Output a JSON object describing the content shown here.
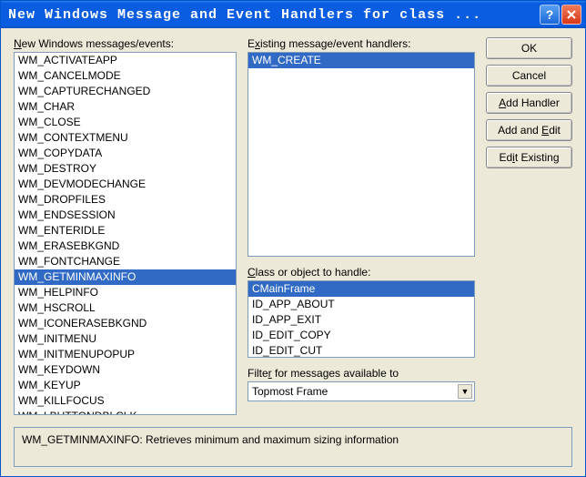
{
  "title": "New Windows Message and Event Handlers for class ...",
  "labels": {
    "new_messages": "New Windows messages/events:",
    "existing": "Existing message/event handlers:",
    "class": "Class or object to handle:",
    "filter": "Filter for messages available to"
  },
  "buttons": {
    "ok": "OK",
    "cancel": "Cancel",
    "add_handler": "Add Handler",
    "add_and_edit": "Add and Edit",
    "edit_existing": "Edit Existing"
  },
  "new_messages": {
    "items": [
      "WM_ACTIVATEAPP",
      "WM_CANCELMODE",
      "WM_CAPTURECHANGED",
      "WM_CHAR",
      "WM_CLOSE",
      "WM_CONTEXTMENU",
      "WM_COPYDATA",
      "WM_DESTROY",
      "WM_DEVMODECHANGE",
      "WM_DROPFILES",
      "WM_ENDSESSION",
      "WM_ENTERIDLE",
      "WM_ERASEBKGND",
      "WM_FONTCHANGE",
      "WM_GETMINMAXINFO",
      "WM_HELPINFO",
      "WM_HSCROLL",
      "WM_ICONERASEBKGND",
      "WM_INITMENU",
      "WM_INITMENUPOPUP",
      "WM_KEYDOWN",
      "WM_KEYUP",
      "WM_KILLFOCUS",
      "WM_LBUTTONDBLCLK"
    ],
    "selected": "WM_GETMINMAXINFO"
  },
  "existing_handlers": {
    "items": [
      "WM_CREATE"
    ],
    "selected": "WM_CREATE"
  },
  "class_list": {
    "items": [
      "CMainFrame",
      "ID_APP_ABOUT",
      "ID_APP_EXIT",
      "ID_EDIT_COPY",
      "ID_EDIT_CUT"
    ],
    "selected": "CMainFrame"
  },
  "filter_select": {
    "value": "Topmost Frame"
  },
  "status": "WM_GETMINMAXINFO:  Retrieves minimum and maximum sizing information"
}
